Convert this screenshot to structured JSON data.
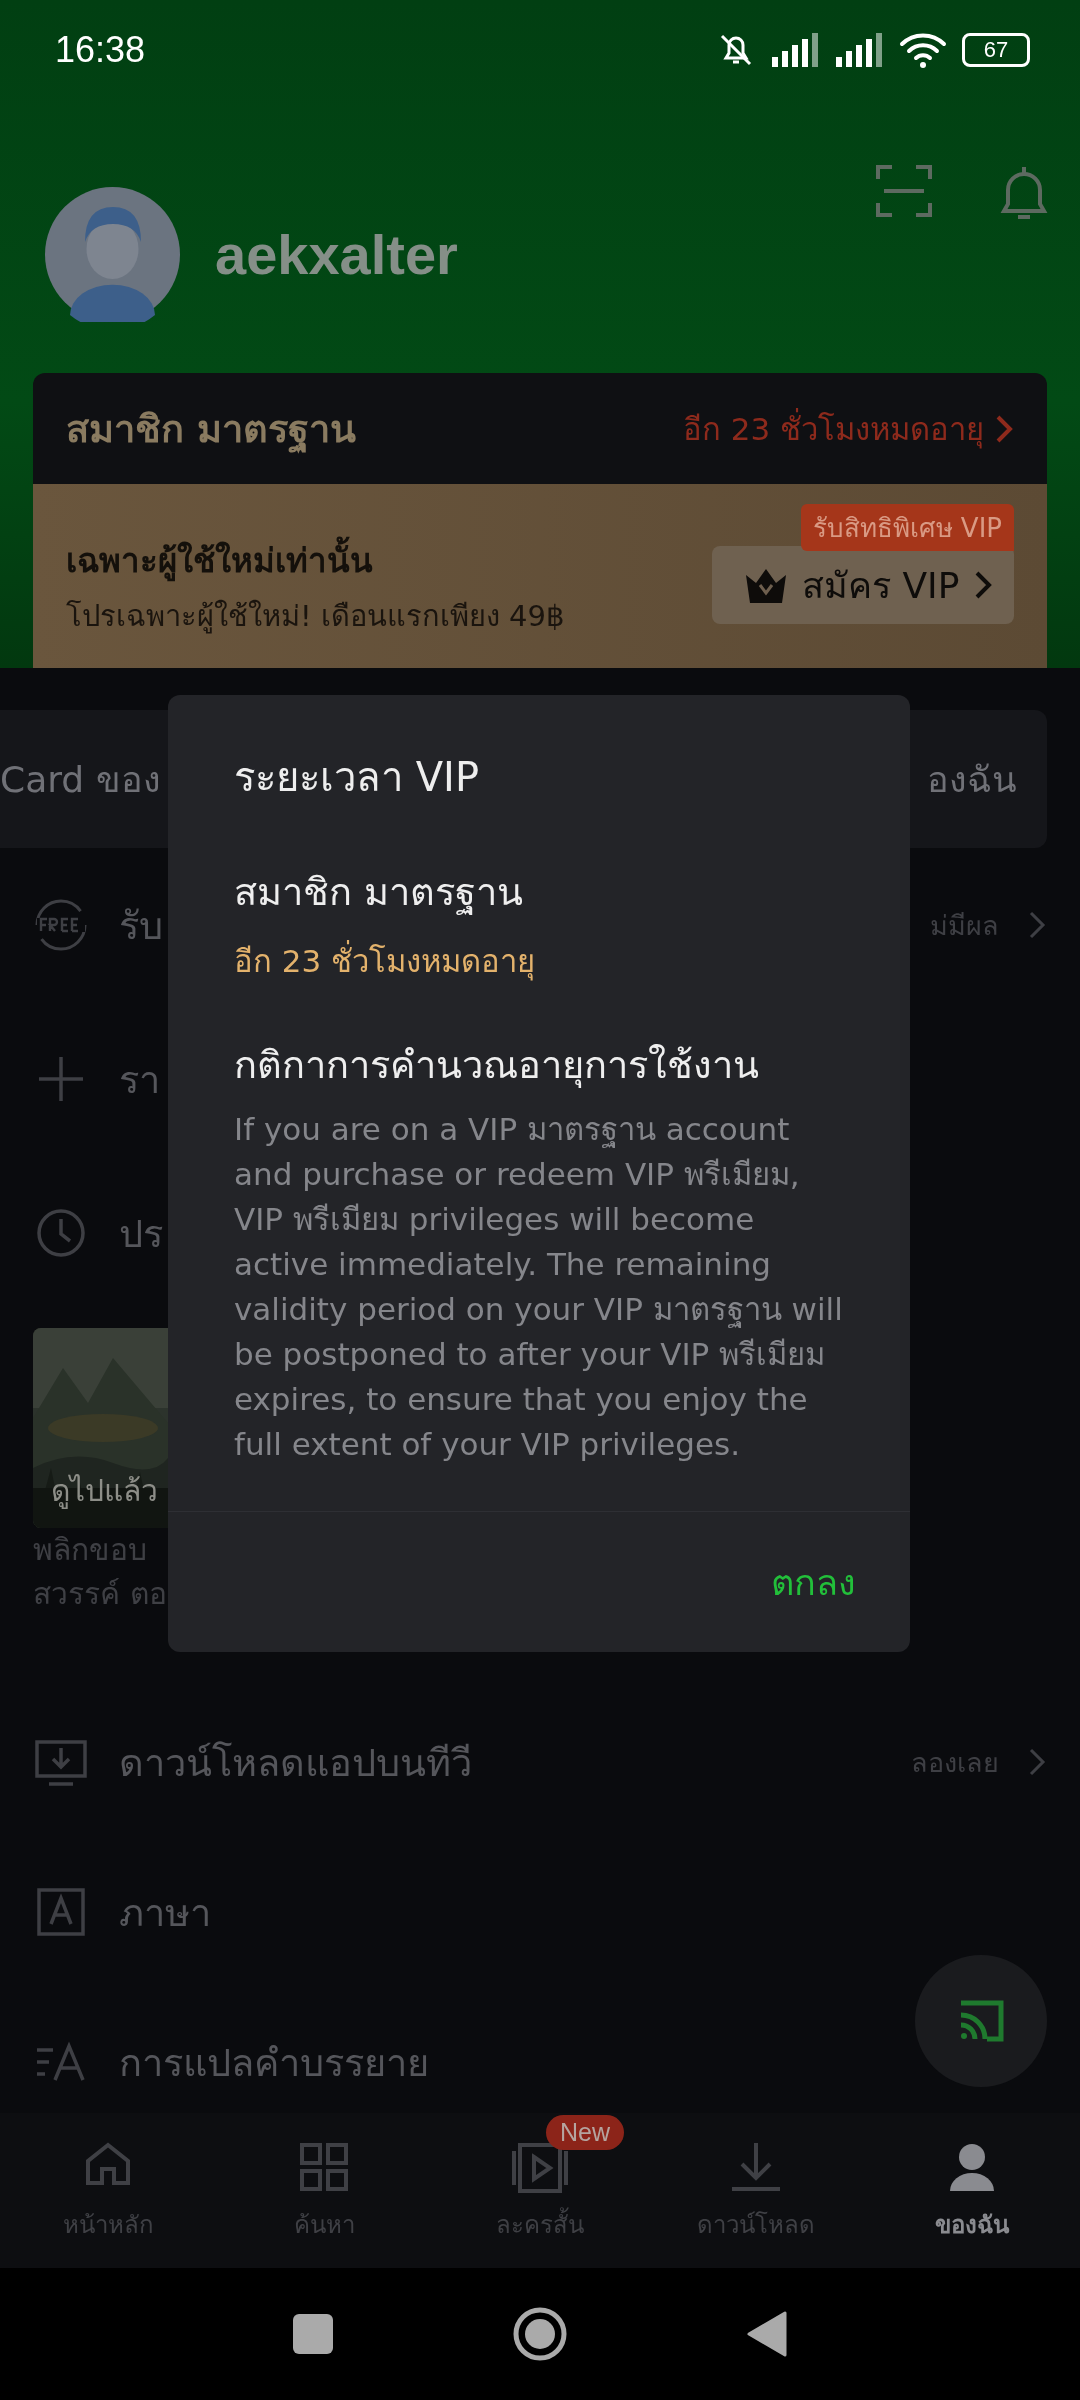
{
  "status_bar": {
    "time": "16:38",
    "battery": "67"
  },
  "profile": {
    "username": "aekxalter"
  },
  "membership": {
    "title": "สมาชิก มาตรฐาน",
    "expiry": "อีก 23 ชั่วโมงหมดอายุ",
    "promo_title": "เฉพาะผู้ใช้ใหม่เท่านั้น",
    "promo_text": "โปรเฉพาะผู้ใช้ใหม่! เดือนแรกเพียง 49฿",
    "badge": "รับสิทธิพิเศษ VIP",
    "button": "สมัคร VIP"
  },
  "card_row": {
    "left": "Card ของ",
    "right": "องฉัน"
  },
  "menu": [
    {
      "kind": "free",
      "label": "รับ",
      "value": "ม่มีผล"
    },
    {
      "kind": "plus",
      "label": "รา"
    },
    {
      "kind": "history",
      "label": "ปร"
    }
  ],
  "history": {
    "overlay": "ดูไปแล้ว",
    "caption": [
      "พลิกขอบ",
      "สวรรค์ ตอ"
    ]
  },
  "menu_lower": [
    {
      "kind": "tv",
      "label": "ดาวน์โหลดแอปบนทีวี",
      "value": "ลองเลย"
    },
    {
      "kind": "language",
      "label": "ภาษา"
    },
    {
      "kind": "subtitle",
      "label": "การแปลคำบรรยาย"
    }
  ],
  "nav": [
    {
      "kind": "home",
      "label": "หน้าหลัก",
      "selected": false
    },
    {
      "kind": "grid",
      "label": "ค้นหา",
      "selected": false
    },
    {
      "kind": "short",
      "label": "ละครสั้น",
      "selected": false,
      "badge": "New"
    },
    {
      "kind": "download",
      "label": "ดาวน์โหลด",
      "selected": false
    },
    {
      "kind": "me",
      "label": "ของฉัน",
      "selected": true
    }
  ],
  "dialog": {
    "title": "ระยะเวลา VIP",
    "plan": "สมาชิก มาตรฐาน",
    "expiry": "อีก 23 ชั่วโมงหมดอายุ",
    "rules_title": "กติกาการคำนวณอายุการใช้งาน",
    "rules_text": "If you are on a VIP มาตรฐาน account and purchase or redeem VIP พรีเมียม, VIP พรีเมียม privileges will become active immediately. The remaining validity period on your VIP มาตรฐาน will be postponed to after your VIP พรีเมียม expires, to ensure that you enjoy the full extent of your VIP privileges.",
    "button": "ตกลง"
  }
}
